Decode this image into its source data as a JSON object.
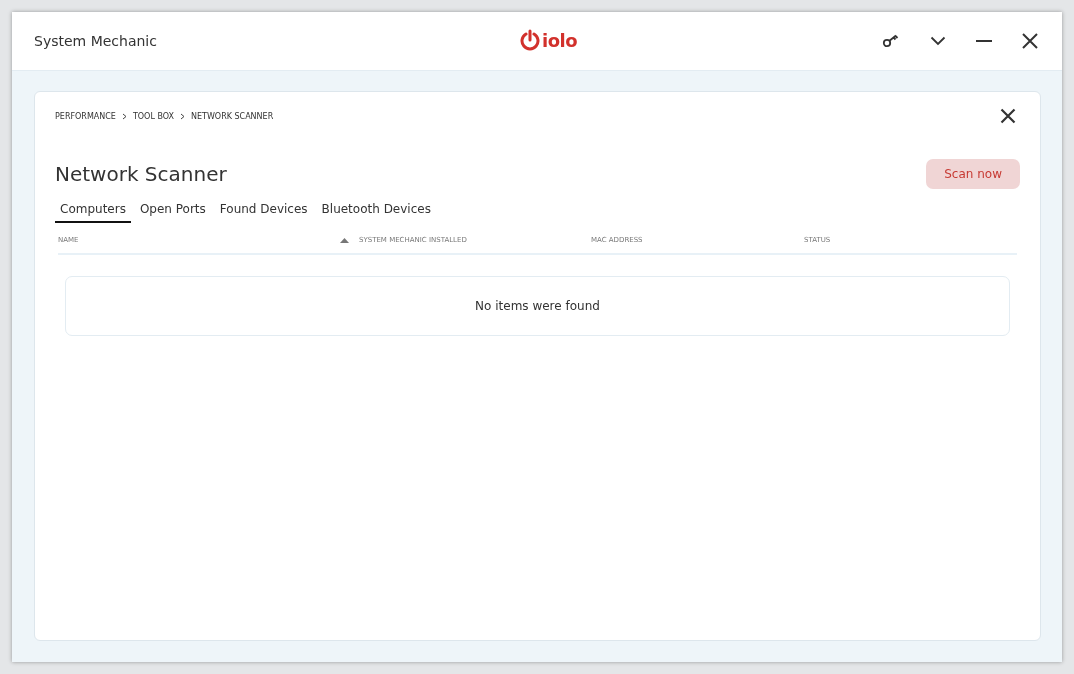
{
  "window": {
    "title": "System Mechanic",
    "logo_text": "iolo"
  },
  "breadcrumb": [
    "PERFORMANCE",
    "TOOL BOX",
    "NETWORK SCANNER"
  ],
  "page": {
    "title": "Network Scanner",
    "scan_button": "Scan now"
  },
  "tabs": [
    {
      "label": "Computers",
      "selected": true
    },
    {
      "label": "Open Ports",
      "selected": false
    },
    {
      "label": "Found Devices",
      "selected": false
    },
    {
      "label": "Bluetooth Devices",
      "selected": false
    }
  ],
  "table": {
    "columns": [
      {
        "label": "NAME",
        "sorted": false
      },
      {
        "label": "SYSTEM MECHANIC INSTALLED",
        "sorted": true
      },
      {
        "label": "MAC ADDRESS",
        "sorted": false
      },
      {
        "label": "STATUS",
        "sorted": false
      }
    ],
    "empty_message": "No items were found"
  }
}
